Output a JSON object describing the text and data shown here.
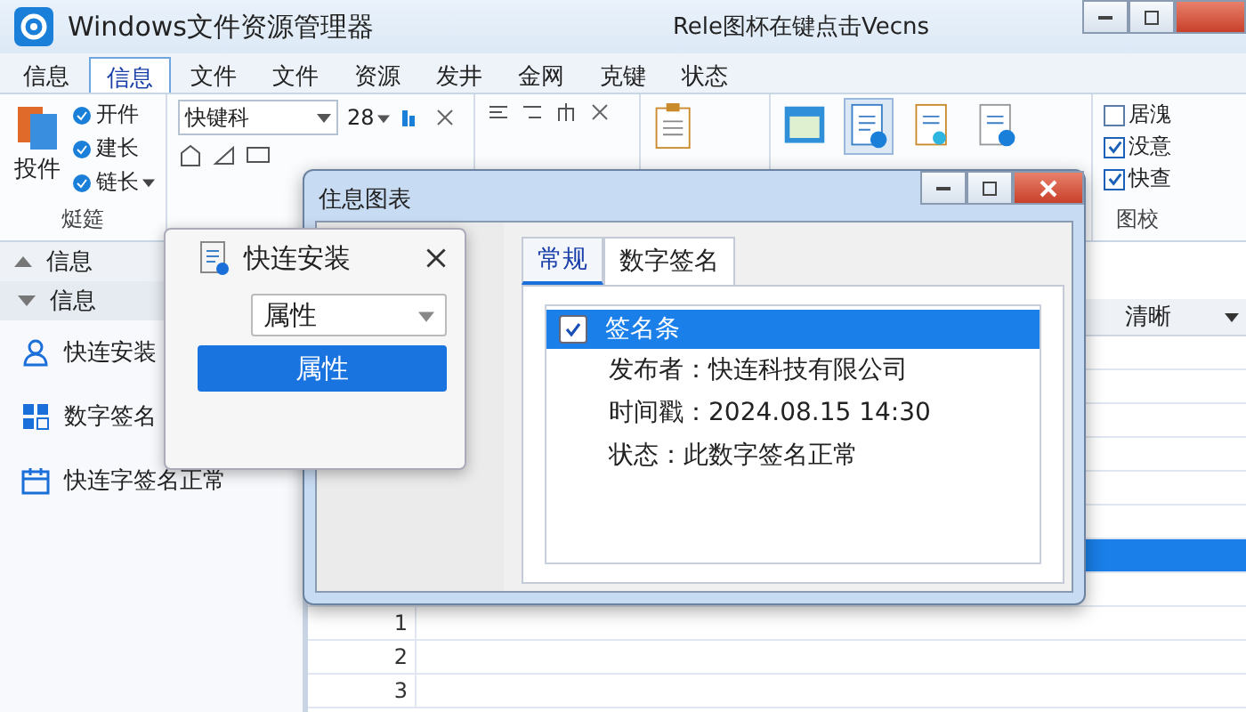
{
  "window": {
    "title": "Windows文件资源管理器",
    "caption": "Rele图杯在键点击Vecns"
  },
  "tabs": [
    {
      "label": "信息",
      "selected": false
    },
    {
      "label": "信息",
      "selected": true
    },
    {
      "label": "文件",
      "selected": false
    },
    {
      "label": "文件",
      "selected": false
    },
    {
      "label": "资源",
      "selected": false
    },
    {
      "label": "发井",
      "selected": false
    },
    {
      "label": "金网",
      "selected": false
    },
    {
      "label": "克键",
      "selected": false
    },
    {
      "label": "状态",
      "selected": false
    }
  ],
  "ribbon": {
    "big_button": "投件",
    "small_buttons": [
      {
        "label": "开件",
        "dropdown": false
      },
      {
        "label": "建长",
        "dropdown": false
      },
      {
        "label": "链长",
        "dropdown": true
      }
    ],
    "group_label": "烶筵",
    "font": "快键科",
    "size": "28",
    "checks": [
      {
        "label": "居溾",
        "checked": false
      },
      {
        "label": "没意",
        "checked": true
      },
      {
        "label": "快查",
        "checked": true
      }
    ],
    "checks_label": "图校"
  },
  "sidebar": {
    "header": "信息",
    "subheader": "信息",
    "items": [
      {
        "label": "快连安装",
        "kind": "person"
      },
      {
        "label": "数字签名",
        "kind": "grid"
      },
      {
        "label": "快连字签名正常",
        "kind": "calendar"
      }
    ]
  },
  "grid": {
    "column_header": "清晰",
    "rows": [
      {
        "selected": false
      },
      {
        "selected": false
      },
      {
        "selected": false
      },
      {
        "selected": false
      },
      {
        "selected": false
      },
      {
        "selected": false
      },
      {
        "selected": true
      },
      {
        "selected": false
      },
      {
        "number": "1",
        "selected": false
      },
      {
        "number": "2",
        "selected": false
      },
      {
        "number": "3",
        "selected": false
      }
    ]
  },
  "dialog": {
    "title": "住息图表",
    "tabs": [
      {
        "label": "常规",
        "selected": true
      },
      {
        "label": "数字签名",
        "selected": false
      }
    ],
    "tree": {
      "label": "签名条",
      "checked": true,
      "selected": true,
      "children": [
        {
          "label": "发布者：快连科技有限公司"
        },
        {
          "label": "时间戳：2024.08.15 14:30"
        },
        {
          "label": "状态：此数字签名正常"
        }
      ]
    }
  },
  "popup": {
    "title": "快连安装",
    "select": "属性",
    "button": "属性"
  }
}
